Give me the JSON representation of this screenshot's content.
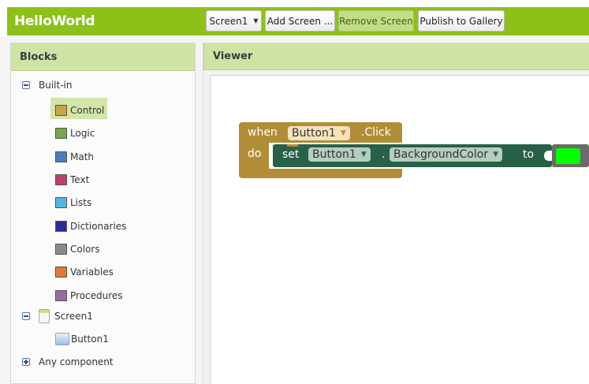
{
  "app": {
    "title": "HelloWorld"
  },
  "toolbar": {
    "screen_select": "Screen1",
    "add_screen": "Add Screen ...",
    "remove_screen": "Remove Screen",
    "publish": "Publish to Gallery"
  },
  "blocks_panel": {
    "title": "Blocks",
    "builtin_label": "Built-in",
    "builtin_items": [
      {
        "label": "Control",
        "color": "#c9a54c"
      },
      {
        "label": "Logic",
        "color": "#7aa64a"
      },
      {
        "label": "Math",
        "color": "#4a7dbf"
      },
      {
        "label": "Text",
        "color": "#c03f6e"
      },
      {
        "label": "Lists",
        "color": "#52b7e0"
      },
      {
        "label": "Dictionaries",
        "color": "#2b2b9e"
      },
      {
        "label": "Colors",
        "color": "#8a8a8a"
      },
      {
        "label": "Variables",
        "color": "#e07a30"
      },
      {
        "label": "Procedures",
        "color": "#9a6aa5"
      }
    ],
    "screen_label": "Screen1",
    "component_label": "Button1",
    "any_component_label": "Any component"
  },
  "viewer": {
    "title": "Viewer",
    "event_block": {
      "when": "when",
      "component": "Button1",
      "event": ".Click",
      "do": "do"
    },
    "set_block": {
      "set": "set",
      "component": "Button1",
      "dot": ".",
      "property": "BackgroundColor",
      "to": "to"
    },
    "color_value": "#00ff00"
  }
}
